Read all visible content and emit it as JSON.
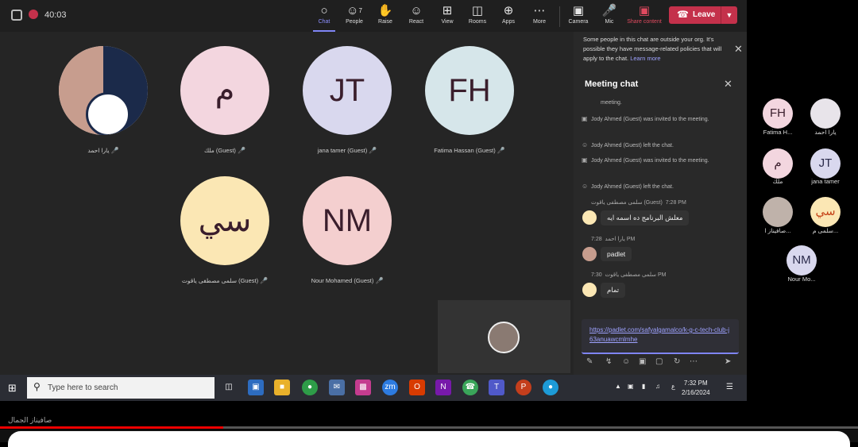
{
  "topbar": {
    "timer": "40:03",
    "tools": [
      {
        "label": "Chat",
        "icon": "chat-icon",
        "active": true
      },
      {
        "label": "People",
        "icon": "people-icon",
        "badge": "7"
      },
      {
        "label": "Raise",
        "icon": "hand-icon"
      },
      {
        "label": "React",
        "icon": "smile-icon"
      },
      {
        "label": "View",
        "icon": "grid-icon"
      },
      {
        "label": "Rooms",
        "icon": "rooms-icon"
      },
      {
        "label": "Apps",
        "icon": "apps-icon"
      },
      {
        "label": "More",
        "icon": "more-icon"
      }
    ],
    "camera": "Camera",
    "mic": "Mic",
    "share": "Share content",
    "leave": "Leave"
  },
  "participants": [
    {
      "name": "يارا احمد",
      "initials": "",
      "color": "#e8e4ea"
    },
    {
      "name": "ملك (Guest)",
      "initials": "م",
      "color": "#f3d6df"
    },
    {
      "name": "jana tamer (Guest)",
      "initials": "JT",
      "color": "#d9d8ee"
    },
    {
      "name": "Fatima Hassan (Guest)",
      "initials": "FH",
      "color": "#d6e6ea"
    },
    {
      "name": "سلمى مصطفى ياقوت (Guest)",
      "initials": "سي",
      "color": "#fbe7b4"
    },
    {
      "name": "Nour Mohamed (Guest)",
      "initials": "NM",
      "color": "#f4cfcf"
    }
  ],
  "chat": {
    "notice": "Some people in this chat are outside your org. It's possible they have message-related policies that will apply to the chat.",
    "notice_link": "Learn more",
    "title": "Meeting chat",
    "system": [
      "meeting.",
      "Jody Ahmed (Guest) was invited to the meeting.",
      "Jody Ahmed (Guest) left the chat.",
      "Jody Ahmed (Guest) was invited to the meeting.",
      "Jody Ahmed (Guest) left the chat."
    ],
    "messages": [
      {
        "sender": "سلمى مصطفى ياقوت (Guest)",
        "time": "7:28 PM",
        "text": "معلش البرنامج ده اسمه ايه"
      },
      {
        "sender": "يارا احمد",
        "time": "7:28 PM",
        "text": "padlet"
      },
      {
        "sender": "سلمى مصطفى ياقوت",
        "time": "7:30 PM",
        "text": "تمام"
      }
    ],
    "compose": "https://padlet.com/safyalgamalco/k-g-c-tech-club-j63anuawcmlmhe"
  },
  "strip": [
    {
      "initials": "FH",
      "name": "Fatima H...",
      "color": "#d6e6ea"
    },
    {
      "initials": "",
      "name": "يارا احمد",
      "color": "#e8e4ea"
    },
    {
      "initials": "م",
      "name": "ملك",
      "color": "#f3d6df"
    },
    {
      "initials": "JT",
      "name": "jana tamer",
      "color": "#d9d8ee"
    },
    {
      "initials": "",
      "name": "صافيناز ا...",
      "color": "#bfb2aa"
    },
    {
      "initials": "سي",
      "name": "سلمى م...",
      "color": "#fbe7b4"
    },
    {
      "initials": "NM",
      "name": "Nour Mo...",
      "color": "#d9d8ee"
    }
  ],
  "taskbar": {
    "search_placeholder": "Type here to search",
    "time": "7:32 PM",
    "date": "2/16/2024"
  },
  "caption": "صافيناز الجمال",
  "video_progress": 0.26
}
